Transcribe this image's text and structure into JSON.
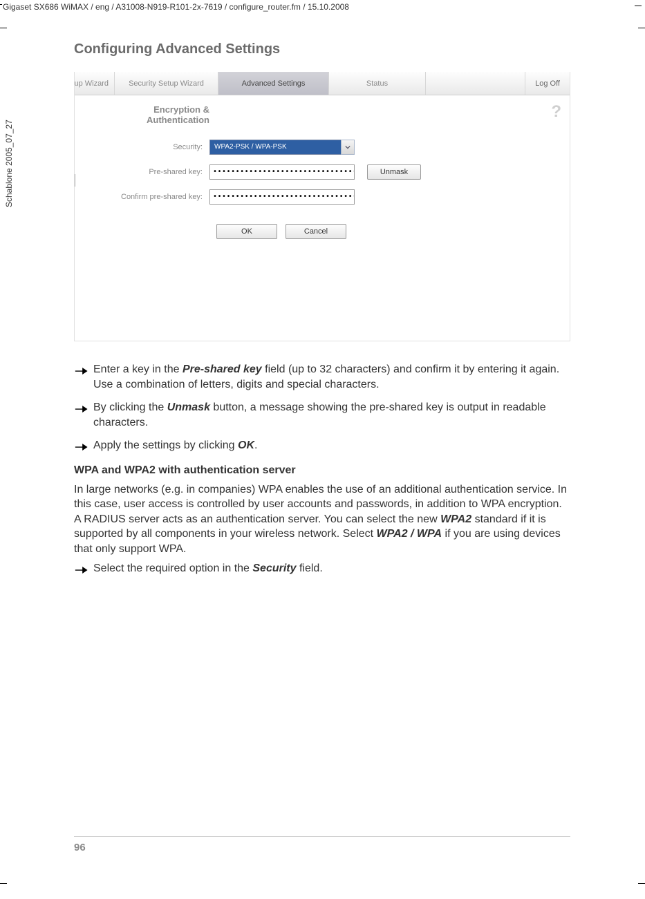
{
  "header": {
    "path_line": "Gigaset SX686 WiMAX / eng / A31008-N919-R101-2x-7619 / configure_router.fm / 15.10.2008",
    "side_text": "Schablone 2005_07_27",
    "page_title": "Configuring Advanced Settings"
  },
  "ui": {
    "tabs": {
      "partial": "up Wizard",
      "security": "Security Setup Wizard",
      "advanced": "Advanced Settings",
      "status": "Status"
    },
    "logoff": "Log Off",
    "help_icon": "?",
    "section_title_line1": "Encryption &",
    "section_title_line2": "Authentication",
    "labels": {
      "security": "Security:",
      "psk": "Pre-shared key:",
      "confirm_psk": "Confirm pre-shared key:"
    },
    "fields": {
      "security_value": "WPA2-PSK / WPA-PSK",
      "psk_value": "••••••••••••••••••••••••••••••••",
      "confirm_value": "••••••••••••••••••••••••••••••••"
    },
    "buttons": {
      "unmask": "Unmask",
      "ok": "OK",
      "cancel": "Cancel"
    }
  },
  "body": {
    "bullets": [
      {
        "pre": "Enter a key in the ",
        "b1": "Pre-shared key",
        "mid": " field (up to 32 characters) and confirm it by entering it again. Use a combination of letters, digits and special characters."
      },
      {
        "pre": "By clicking the ",
        "b1": "Unmask",
        "mid": " button, a message showing the pre-shared key is output in readable characters."
      },
      {
        "pre": "Apply the settings by clicking ",
        "b1": "OK",
        "mid": "."
      }
    ],
    "subhead": "WPA and WPA2 with authentication server",
    "para_pre": "In large networks (e.g. in companies) WPA enables the use of an additional authentication service. In this case, user access is controlled by user accounts and passwords, in addition to WPA encryption. A RADIUS server acts as an authentication server. You can select the new ",
    "para_b1": "WPA2",
    "para_mid": " standard if it is supported by all components in your wireless network. Select ",
    "para_b2": "WPA2 / WPA",
    "para_end": " if you are using devices that only support WPA.",
    "bullet4_pre": "Select the required option in the ",
    "bullet4_b": "Security",
    "bullet4_end": " field."
  },
  "page_number": "96"
}
